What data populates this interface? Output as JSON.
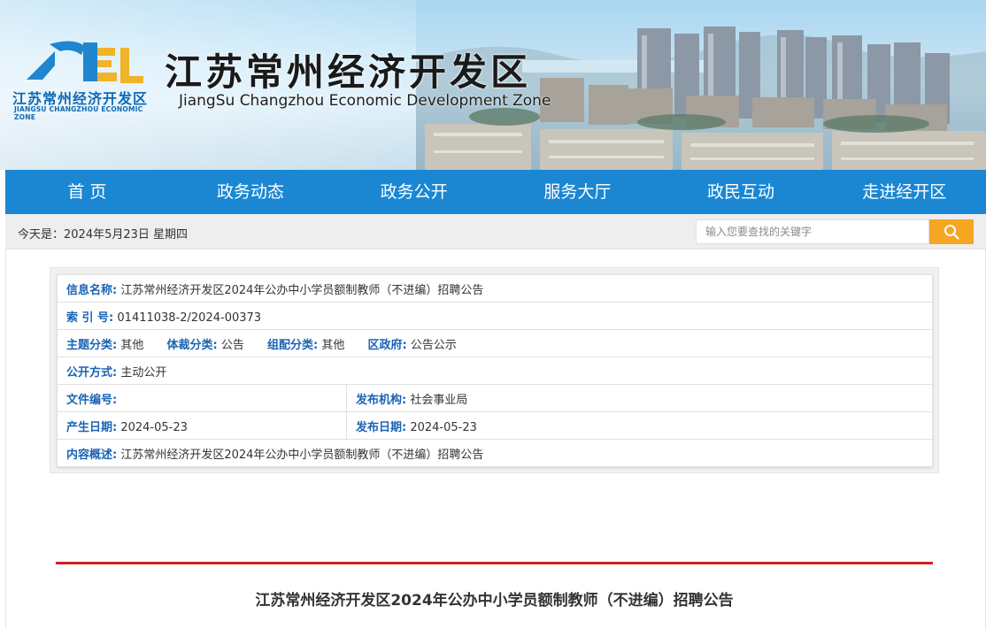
{
  "header": {
    "title_cn": "江苏常州经济开发区",
    "title_en": "JiangSu Changzhou Economic Development Zone",
    "logo_caption_cn": "江苏常州经济开发区",
    "logo_caption_en": "JIANGSU CHANGZHOU ECONOMIC ZONE",
    "logo_letters": "CJE"
  },
  "nav": {
    "items": [
      {
        "label": "首 页"
      },
      {
        "label": "政务动态"
      },
      {
        "label": "政务公开"
      },
      {
        "label": "服务大厅"
      },
      {
        "label": "政民互动"
      },
      {
        "label": "走进经开区"
      }
    ],
    "background": "#1b87d3"
  },
  "infobar": {
    "date_text": "今天是：2024年5月23日 星期四",
    "search_placeholder": "输入您要查找的关键字",
    "search_button_color": "#f5a623",
    "search_icon": "search-icon"
  },
  "meta": {
    "info_name_label": "信息名称:",
    "info_name_value": "江苏常州经济开发区2024年公办中小学员额制教师（不进编）招聘公告",
    "index_label": "索 引 号:",
    "index_value": "01411038-2/2024-00373",
    "topic_label": "主题分类:",
    "topic_value": "其他",
    "genre_label": "体裁分类:",
    "genre_value": "公告",
    "org_label": "组配分类:",
    "org_value": "其他",
    "gov_label": "区政府:",
    "gov_value": "公告公示",
    "open_label": "公开方式:",
    "open_value": "主动公开",
    "docno_label": "文件编号:",
    "docno_value": "",
    "publisher_label": "发布机构:",
    "publisher_value": "社会事业局",
    "created_label": "产生日期:",
    "created_value": "2024-05-23",
    "published_label": "发布日期:",
    "published_value": "2024-05-23",
    "summary_label": "内容概述:",
    "summary_value": "江苏常州经济开发区2024年公办中小学员额制教师（不进编）招聘公告"
  },
  "article": {
    "title": "江苏常州经济开发区2024年公办中小学员额制教师（不进编）招聘公告",
    "rule_color": "#d81e1e"
  }
}
